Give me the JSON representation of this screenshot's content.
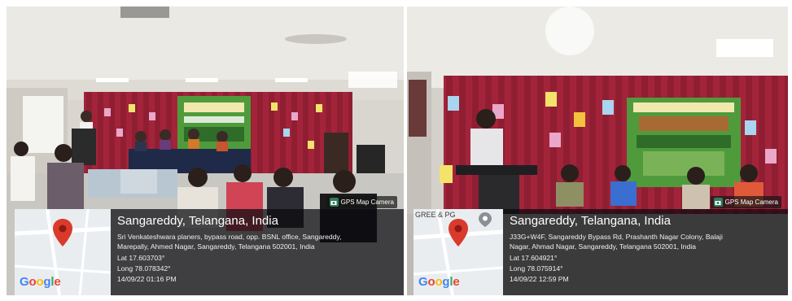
{
  "photos": [
    {
      "camera_tag": "GPS Map Camera",
      "location_title": "Sangareddy, Telangana, India",
      "address_line1": "Sri Venkateshwara planers, bypass road, opp. BSNL office, Sangareddy,",
      "address_line2": "Marepally, Ahmed Nagar, Sangareddy, Telangana 502001, India",
      "lat": "Lat 17.603703°",
      "long": "Long 78.078342°",
      "datetime": "14/09/22 01:16 PM",
      "map_logo": "Google"
    },
    {
      "camera_tag": "GPS Map Camera",
      "location_title": "Sangareddy, Telangana, India",
      "address_line1": "J33G+W4F, Sangareddy Bypass Rd, Prashanth Nagar Colony, Balaji",
      "address_line2": "Nagar, Ahmad Nagar, Sangareddy, Telangana 502001, India",
      "lat": "Lat 17.604921°",
      "long": "Long 78.075914°",
      "datetime": "14/09/22 12:59 PM",
      "map_logo": "Google",
      "map_label": "GREE & PG"
    }
  ],
  "colors": {
    "curtain": "#a3243a",
    "banner": "#4f9b3b",
    "wall": "#e4e2de",
    "overlay": "#0a0a0e",
    "map_pin": "#d93a2b"
  }
}
